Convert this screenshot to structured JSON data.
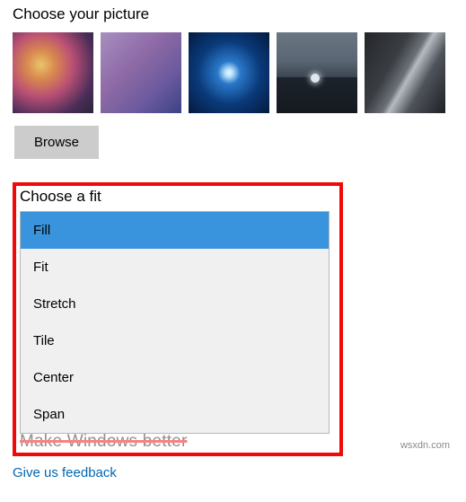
{
  "picture": {
    "title": "Choose your picture",
    "thumbs": [
      "gradient-warm",
      "gradient-purple",
      "windows-light",
      "night-moon",
      "cliff-rock"
    ],
    "browse_label": "Browse"
  },
  "fit": {
    "title": "Choose a fit",
    "options": [
      "Fill",
      "Fit",
      "Stretch",
      "Tile",
      "Center",
      "Span"
    ],
    "selected_index": 0
  },
  "obscured_heading": "Make Windows better",
  "feedback_link": "Give us feedback",
  "watermark": "wsxdn.com"
}
